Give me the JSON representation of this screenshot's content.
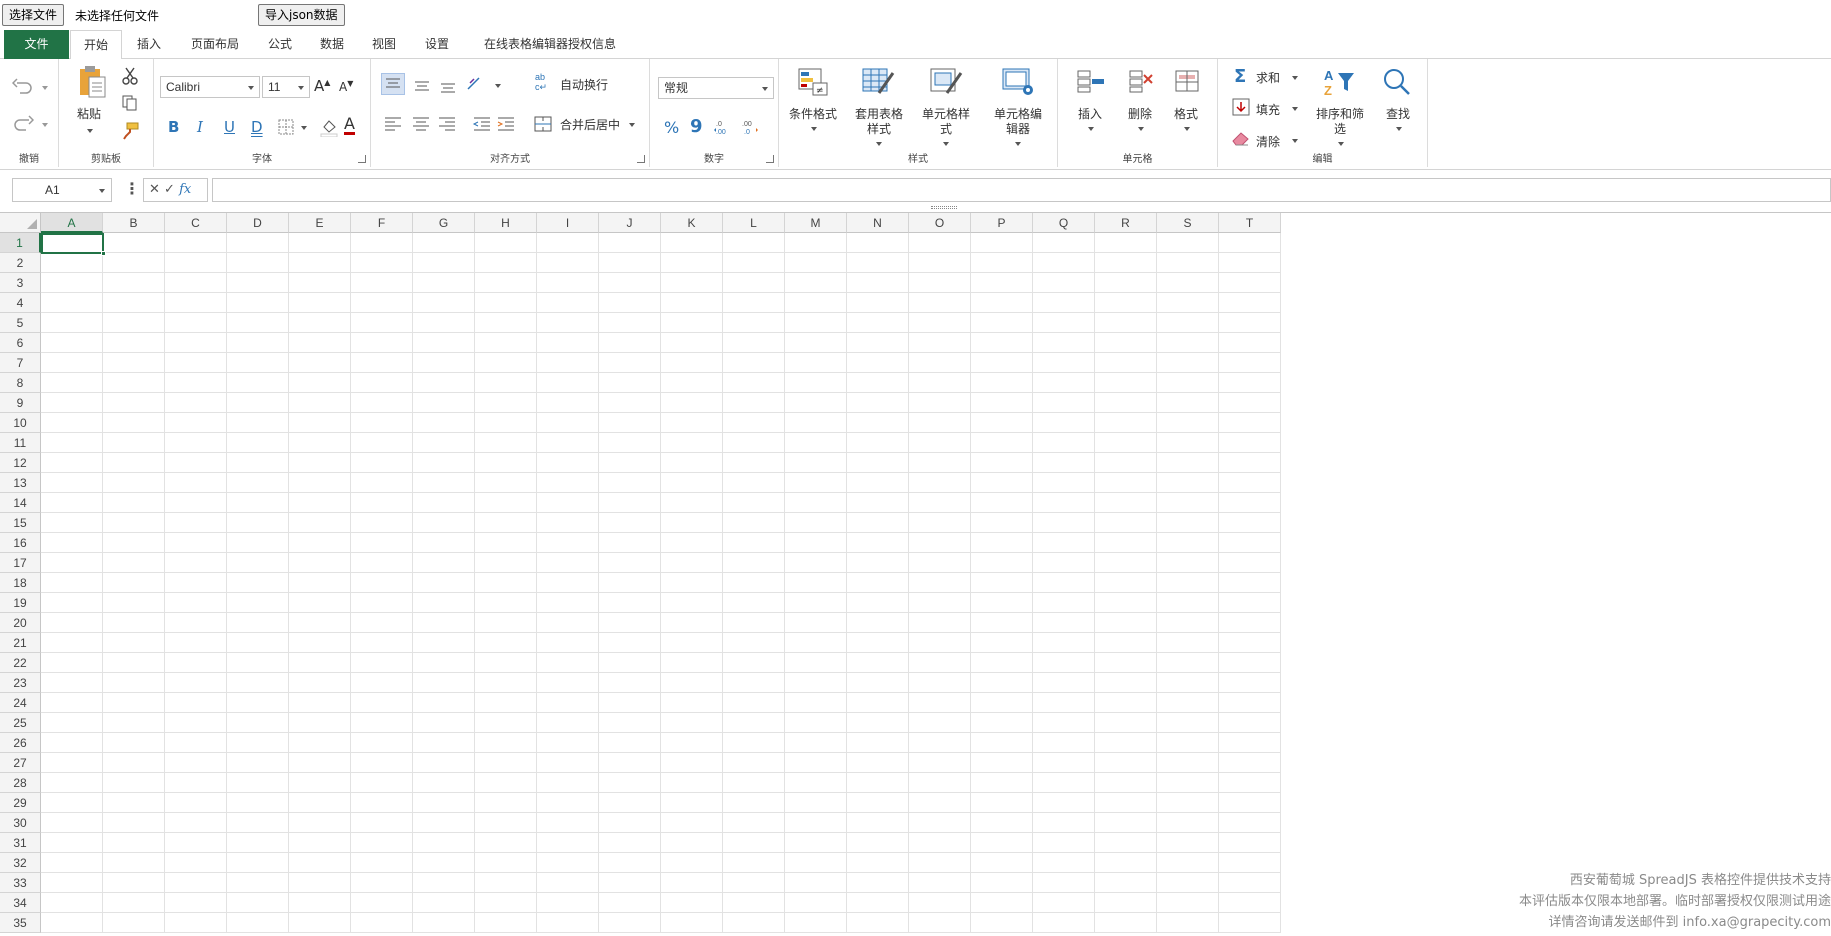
{
  "topbar": {
    "choose_file": "选择文件",
    "no_file": "未选择任何文件",
    "import_json": "导入json数据"
  },
  "tabs": [
    {
      "label": "文件"
    },
    {
      "label": "开始",
      "active": true
    },
    {
      "label": "插入"
    },
    {
      "label": "页面布局"
    },
    {
      "label": "公式"
    },
    {
      "label": "数据"
    },
    {
      "label": "视图"
    },
    {
      "label": "设置"
    },
    {
      "label": "在线表格编辑器授权信息"
    }
  ],
  "ribbon": {
    "undo_group": "撤销",
    "clipboard_group": "剪贴板",
    "paste": "粘贴",
    "font_group": "字体",
    "font_name": "Calibri",
    "font_size": "11",
    "bold": "B",
    "italic": "I",
    "underline": "U",
    "double_underline": "D",
    "font_color_glyph": "A",
    "align_group": "对齐方式",
    "wrap_text": "自动换行",
    "merge_center": "合并后居中",
    "number_group": "数字",
    "number_format": "常规",
    "percent": "%",
    "comma": "9",
    "styles_group": "样式",
    "conditional_format": "条件格式",
    "table_style_1": "套用表格",
    "table_style_2": "样式",
    "cell_style_1": "单元格样",
    "cell_style_2": "式",
    "cell_editor_1": "单元格编",
    "cell_editor_2": "辑器",
    "cells_group": "单元格",
    "insert": "插入",
    "delete": "删除",
    "format": "格式",
    "editing_group": "编辑",
    "sum": "求和",
    "fill": "填充",
    "clear": "清除",
    "sort_filter_1": "排序和筛",
    "sort_filter_2": "选",
    "find": "查找"
  },
  "formula_bar": {
    "name_box": "A1",
    "fx": "fx",
    "cancel": "✕",
    "confirm": "✓",
    "value": ""
  },
  "sheet": {
    "columns": [
      "A",
      "B",
      "C",
      "D",
      "E",
      "F",
      "G",
      "H",
      "I",
      "J",
      "K",
      "L",
      "M",
      "N",
      "O",
      "P",
      "Q",
      "R",
      "S",
      "T"
    ],
    "rows": [
      "1",
      "2",
      "3",
      "4",
      "5",
      "6",
      "7",
      "8",
      "9",
      "10",
      "11",
      "12",
      "13",
      "14",
      "15",
      "16",
      "17",
      "18",
      "19",
      "20",
      "21",
      "22",
      "23",
      "24",
      "25",
      "26",
      "27",
      "28",
      "29",
      "30",
      "31",
      "32",
      "33",
      "34",
      "35"
    ],
    "active_cell": "A1"
  },
  "watermark": {
    "line1": "西安葡萄城 SpreadJS 表格控件提供技术支持",
    "line2": "本评估版本仅限本地部署。临时部署授权仅限测试用途",
    "line3": "详情咨询请发送邮件到 info.xa@grapecity.com"
  },
  "colors": {
    "accent": "#217346",
    "icon_blue": "#2e75b6"
  }
}
